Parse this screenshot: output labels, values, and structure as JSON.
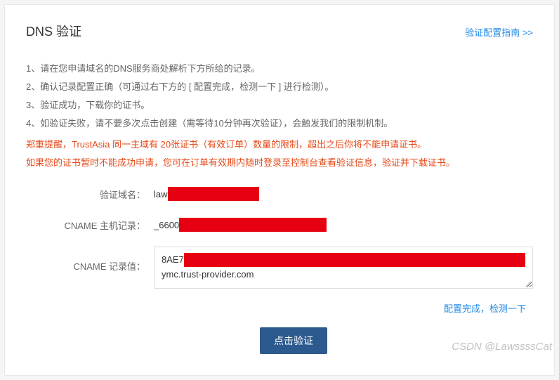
{
  "header": {
    "title": "DNS 验证",
    "guide_link": "验证配置指南 >>"
  },
  "instructions": [
    "1、请在您申请域名的DNS服务商处解析下方所给的记录。",
    "2、确认记录配置正确（可通过右下方的 [ 配置完成，检测一下 ] 进行检测）。",
    "3、验证成功，下载你的证书。",
    "4、如验证失败，请不要多次点击创建（需等待10分钟再次验证），会触发我们的限制机制。"
  ],
  "warning": [
    "郑重提醒，TrustAsia 同一主域有 20张证书（有效订单）数量的限制，超出之后你将不能申请证书。",
    "如果您的证书暂时不能成功申请，您可在订单有效期内随时登录至控制台查看验证信息，验证并下载证书。"
  ],
  "form": {
    "domain_label": "验证域名：",
    "domain_prefix": "law",
    "cname_host_label": "CNAME 主机记录：",
    "cname_host_prefix": "_6600",
    "cname_value_label": "CNAME 记录值：",
    "cname_value_line1_prefix": "8AE7",
    "cname_value_line2": "ymc.trust-provider.com"
  },
  "actions": {
    "check_link": "配置完成，检测一下",
    "verify_button": "点击验证"
  },
  "watermark": "CSDN @LawssssCat"
}
